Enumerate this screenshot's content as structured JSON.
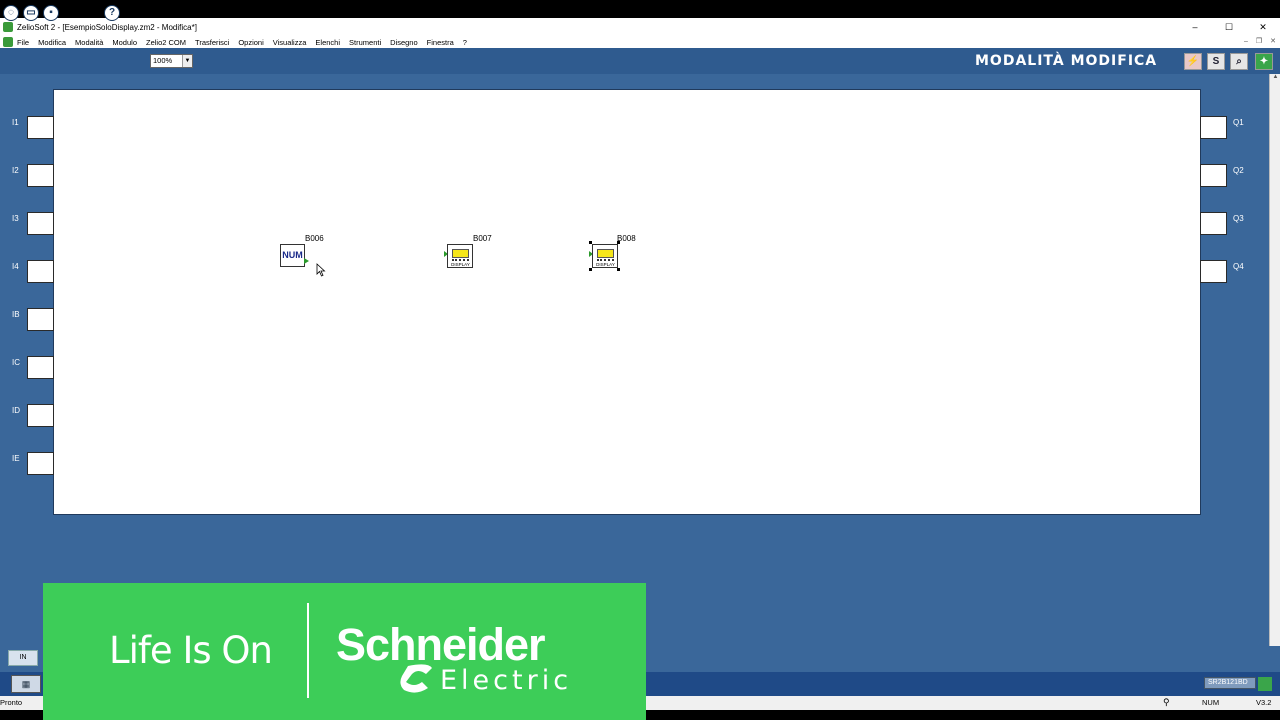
{
  "window": {
    "title": "ZelioSoft 2 - [EsempioSoloDisplay.zm2 - Modifica*]",
    "controls": {
      "minimize": "–",
      "maximize": "☐",
      "close": "✕"
    }
  },
  "menu": {
    "items": [
      "File",
      "Modifica",
      "Modalità",
      "Modulo",
      "Zelio2 COM",
      "Trasferisci",
      "Opzioni",
      "Visualizza",
      "Elenchi",
      "Strumenti",
      "Disegno",
      "Finestra",
      "?"
    ],
    "mdi_controls": {
      "minimize": "–",
      "restore": "❐",
      "close": "✕"
    }
  },
  "toolbar": {
    "new_icon": "new-file-icon",
    "open_icon": "open-folder-icon",
    "save_icon": "save-icon",
    "help_label": "?",
    "zoom_value": "100%",
    "mode_title": "MODALITÀ MODIFICA",
    "mode_buttons": [
      "⚡",
      "S",
      "⌕",
      "✦"
    ]
  },
  "inputs": [
    "I1",
    "I2",
    "I3",
    "I4",
    "IB",
    "IC",
    "ID",
    "IE"
  ],
  "outputs": [
    "Q1",
    "Q2",
    "Q3",
    "Q4"
  ],
  "blocks": {
    "b006": {
      "label": "B006",
      "text": "NUM"
    },
    "b007": {
      "label": "B007",
      "text": "DISPLAY"
    },
    "b008": {
      "label": "B008",
      "text": "DISPLAY"
    }
  },
  "bottom": {
    "in_tab": "IN",
    "model": "SR2B121BD",
    "status_left": "Pronto",
    "status_num": "NUM",
    "status_version": "V3.2"
  },
  "banner": {
    "life_is_on": "Life Is On",
    "brand": "Schneider",
    "brand_sub": "Electric"
  },
  "colors": {
    "workspace": "#3a679a",
    "toolbar": "#2f5b8f",
    "banner_green": "#3dcd58"
  }
}
